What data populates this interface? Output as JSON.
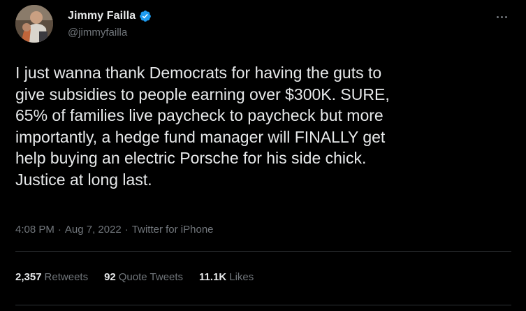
{
  "user": {
    "display_name": "Jimmy Failla",
    "handle": "@jimmyfailla",
    "verified_icon": "verified-badge-icon",
    "accent_color": "#1d9bf0"
  },
  "tweet": {
    "text": "I just wanna thank Democrats for having the guts to\ngive subsidies to people earning over $300K. SURE,\n65% of families live paycheck to paycheck but more\nimportantly, a hedge fund manager will FINALLY get\nhelp buying an electric Porsche for his side chick.\nJustice at long last."
  },
  "meta": {
    "time": "4:08 PM",
    "separator": "·",
    "date": "Aug 7, 2022",
    "source": "Twitter for iPhone"
  },
  "stats": {
    "retweets_count": "2,357",
    "retweets_label": "Retweets",
    "quote_count": "92",
    "quote_label": "Quote Tweets",
    "likes_count": "11.1K",
    "likes_label": "Likes"
  },
  "colors": {
    "background": "#000000",
    "text": "#e7e9ea",
    "secondary_text": "#71767b",
    "divider": "#2f3336"
  }
}
